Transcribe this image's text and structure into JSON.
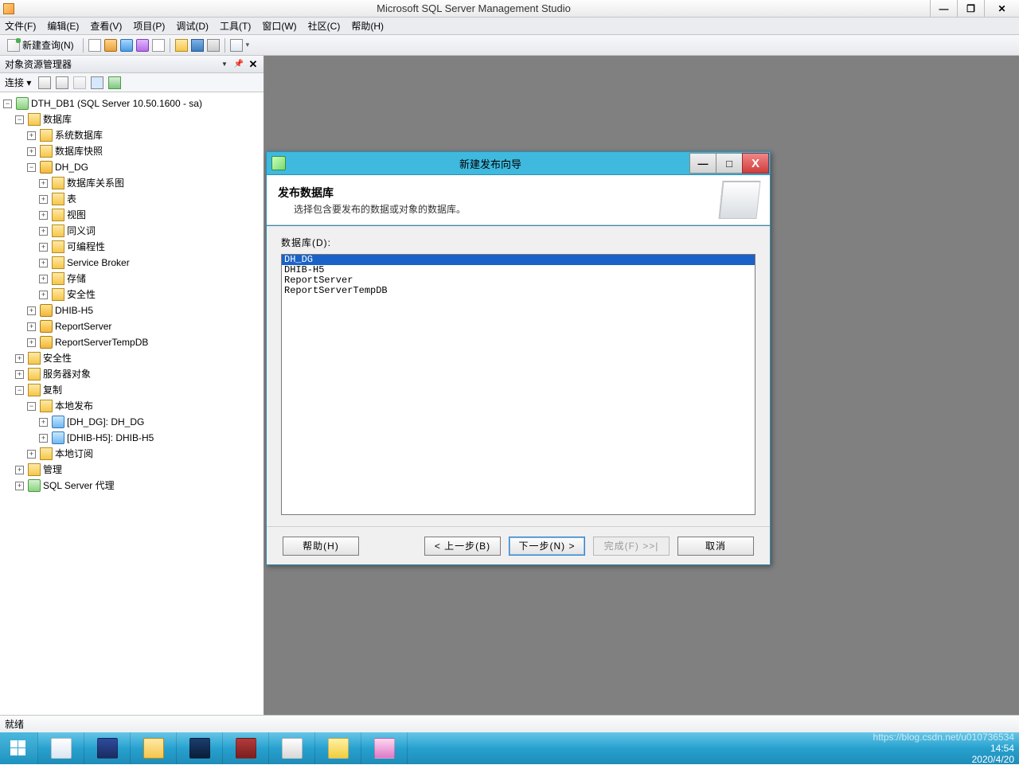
{
  "window": {
    "title": "Microsoft SQL Server Management Studio",
    "min": "—",
    "max": "❐",
    "close": "✕"
  },
  "menubar": {
    "file": "文件(F)",
    "edit": "编辑(E)",
    "view": "查看(V)",
    "project": "项目(P)",
    "debug": "调试(D)",
    "tools": "工具(T)",
    "window": "窗口(W)",
    "community": "社区(C)",
    "help": "帮助(H)"
  },
  "toolbar": {
    "new_query": "新建查询(N)"
  },
  "panel": {
    "title": "对象资源管理器",
    "connect_label": "连接 ▾",
    "tree": {
      "server": "DTH_DB1 (SQL Server 10.50.1600 - sa)",
      "databases": "数据库",
      "sysdb": "系统数据库",
      "dbsnap": "数据库快照",
      "dh_dg": "DH_DG",
      "ddg_children": {
        "diagrams": "数据库关系图",
        "tables": "表",
        "views": "视图",
        "synonyms": "同义词",
        "programmability": "可编程性",
        "service_broker": "Service Broker",
        "storage": "存储",
        "security": "安全性"
      },
      "dhib": "DHIB-H5",
      "reportserver": "ReportServer",
      "reportservertmp": "ReportServerTempDB",
      "sec": "安全性",
      "srvobj": "服务器对象",
      "replication": "复制",
      "localpub": "本地发布",
      "pub1": "[DH_DG]: DH_DG",
      "pub2": "[DHIB-H5]: DHIB-H5",
      "localsub": "本地订阅",
      "mgmt": "管理",
      "agent": "SQL Server 代理"
    }
  },
  "dialog": {
    "title": "新建发布向导",
    "min": "—",
    "max": "□",
    "close": "X",
    "head_title": "发布数据库",
    "head_sub": "选择包含要发布的数据或对象的数据库。",
    "list_label": "数据库(D):",
    "items": [
      "DH_DG",
      "DHIB-H5",
      "ReportServer",
      "ReportServerTempDB"
    ],
    "selected": "DH_DG",
    "btn_help": "帮助(H)",
    "btn_back": "< 上一步(B)",
    "btn_next": "下一步(N) >",
    "btn_finish": "完成(F) >>|",
    "btn_cancel": "取消"
  },
  "statusbar": {
    "ready": "就绪"
  },
  "taskbar": {
    "time": "14:54",
    "date": "2020/4/20",
    "watermark": "https://blog.csdn.net/u010736534"
  }
}
